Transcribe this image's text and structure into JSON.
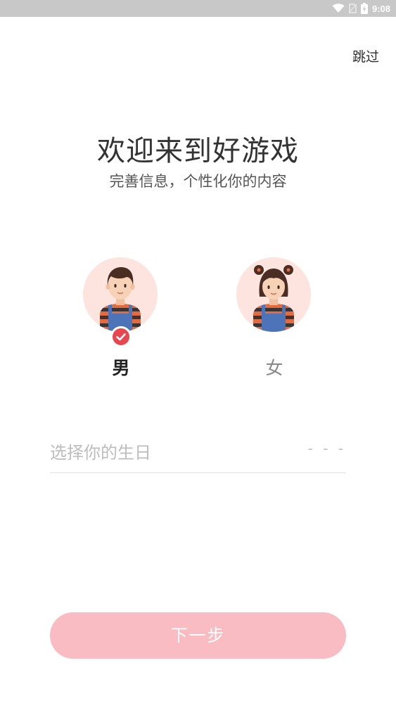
{
  "status_bar": {
    "time": "9:08",
    "icons": [
      "wifi-icon",
      "no-sim-icon",
      "battery-charging-icon"
    ]
  },
  "header": {
    "skip_label": "跳过"
  },
  "welcome": {
    "title": "欢迎来到好游戏",
    "subtitle": "完善信息，个性化你的内容"
  },
  "gender": {
    "selected": "male",
    "male_label": "男",
    "female_label": "女"
  },
  "birthday": {
    "placeholder": "选择你的生日",
    "value": "- - -"
  },
  "footer": {
    "next_label": "下一步"
  },
  "colors": {
    "accent_disabled": "#f9bcc3",
    "avatar_bg": "#fde4df",
    "check": "#e8474f"
  }
}
